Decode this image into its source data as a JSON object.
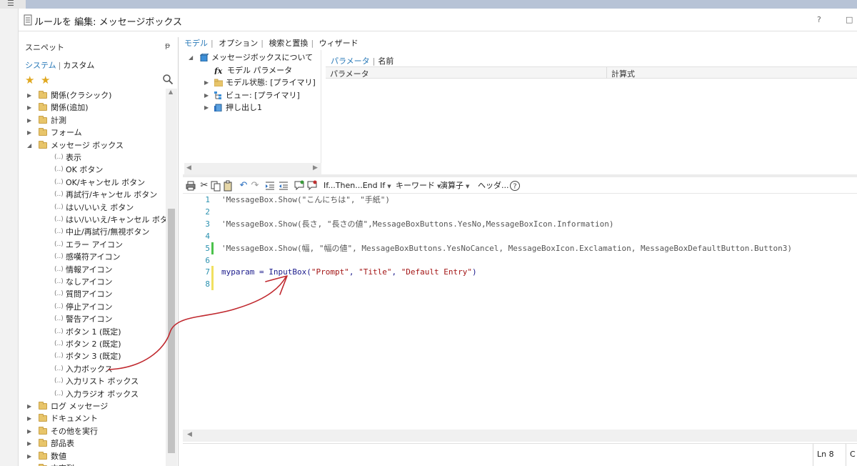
{
  "window": {
    "title": "ルールを 編集: メッセージボックス",
    "help_label": "?",
    "restore_label": "□"
  },
  "snippets": {
    "header": "スニペット",
    "pin_label": "ᵽ",
    "tabs": [
      "システム",
      "カスタム"
    ],
    "tree": [
      {
        "type": "folder",
        "label": "関係(クラシック)",
        "expanded": false
      },
      {
        "type": "folder",
        "label": "関係(追加)",
        "expanded": false
      },
      {
        "type": "folder",
        "label": "計測",
        "expanded": false
      },
      {
        "type": "folder",
        "label": "フォーム",
        "expanded": false
      },
      {
        "type": "folder",
        "label": "メッセージ ボックス",
        "expanded": true
      },
      {
        "type": "snippet",
        "label": "表示"
      },
      {
        "type": "snippet",
        "label": "OK ボタン"
      },
      {
        "type": "snippet",
        "label": "OK/キャンセル ボタン"
      },
      {
        "type": "snippet",
        "label": "再試行/キャンセル ボタン"
      },
      {
        "type": "snippet",
        "label": "はい/いいえ ボタン"
      },
      {
        "type": "snippet",
        "label": "はい/いいえ/キャンセル ボタン"
      },
      {
        "type": "snippet",
        "label": "中止/再試行/無視ボタン"
      },
      {
        "type": "snippet",
        "label": "エラー アイコン"
      },
      {
        "type": "snippet",
        "label": "感嘆符アイコン"
      },
      {
        "type": "snippet",
        "label": "情報アイコン"
      },
      {
        "type": "snippet",
        "label": "なしアイコン"
      },
      {
        "type": "snippet",
        "label": "質問アイコン"
      },
      {
        "type": "snippet",
        "label": "停止アイコン"
      },
      {
        "type": "snippet",
        "label": "警告アイコン"
      },
      {
        "type": "snippet",
        "label": "ボタン 1 (既定)"
      },
      {
        "type": "snippet",
        "label": "ボタン 2 (既定)"
      },
      {
        "type": "snippet",
        "label": "ボタン 3 (既定)"
      },
      {
        "type": "snippet",
        "label": "入力ボックス"
      },
      {
        "type": "snippet",
        "label": "入力リスト ボックス"
      },
      {
        "type": "snippet",
        "label": "入力ラジオ ボックス"
      },
      {
        "type": "folder",
        "label": "ログ メッセージ",
        "expanded": false
      },
      {
        "type": "folder",
        "label": "ドキュメント",
        "expanded": false
      },
      {
        "type": "folder",
        "label": "その他を実行",
        "expanded": false
      },
      {
        "type": "folder",
        "label": "部品表",
        "expanded": false
      },
      {
        "type": "folder",
        "label": "数値",
        "expanded": false
      },
      {
        "type": "folder",
        "label": "文字列",
        "expanded": false
      }
    ]
  },
  "ribbon": {
    "tabs": [
      "モデル",
      "オプション",
      "検索と置換",
      "ウィザード"
    ]
  },
  "model_tree": [
    {
      "label": "メッセージボックスについて",
      "icon": "cube-icon",
      "arrow": "expanded"
    },
    {
      "label": "モデル パラメータ",
      "icon": "fx-icon",
      "arrow": "none"
    },
    {
      "label": "モデル状態: [プライマリ]",
      "icon": "folder-icon",
      "arrow": "collapsed"
    },
    {
      "label": "ビュー: [プライマリ]",
      "icon": "view-tree-icon",
      "arrow": "collapsed"
    },
    {
      "label": "押し出し1",
      "icon": "extrude-icon",
      "arrow": "collapsed"
    }
  ],
  "params": {
    "tabs": [
      "パラメータ",
      "名前"
    ],
    "columns": [
      "パラメータ",
      "計算式"
    ]
  },
  "toolbar": {
    "if_then": "If...Then...End If",
    "keyword": "キーワード",
    "operator": "演算子",
    "header": "ヘッダ...",
    "help": "?"
  },
  "code": {
    "lines": [
      {
        "n": "1",
        "text": "'MessageBox.Show(\"こんにちは\", \"手紙\")",
        "mark": ""
      },
      {
        "n": "2",
        "text": "",
        "mark": ""
      },
      {
        "n": "3",
        "text": "'MessageBox.Show(長さ, \"長さの値\",MessageBoxButtons.YesNo,MessageBoxIcon.Information)",
        "mark": ""
      },
      {
        "n": "4",
        "text": "",
        "mark": ""
      },
      {
        "n": "5",
        "text": "'MessageBox.Show(幅, \"幅の値\", MessageBoxButtons.YesNoCancel, MessageBoxIcon.Exclamation, MessageBoxDefaultButton.Button3)",
        "mark": "#4cc24c"
      },
      {
        "n": "6",
        "text": "",
        "mark": ""
      },
      {
        "n": "7",
        "text": "myparam = InputBox(\"Prompt\", \"Title\", \"Default Entry\")",
        "mark": "#f0e060",
        "highlight": true
      },
      {
        "n": "8",
        "text": "",
        "mark": "#f0e060"
      }
    ]
  },
  "status": {
    "line": "Ln 8",
    "col": "C"
  },
  "colors": {
    "accent": "#2a7ab8",
    "annotation": "#c0282e",
    "changed_green": "#4cc24c",
    "changed_yellow": "#f0e060"
  }
}
